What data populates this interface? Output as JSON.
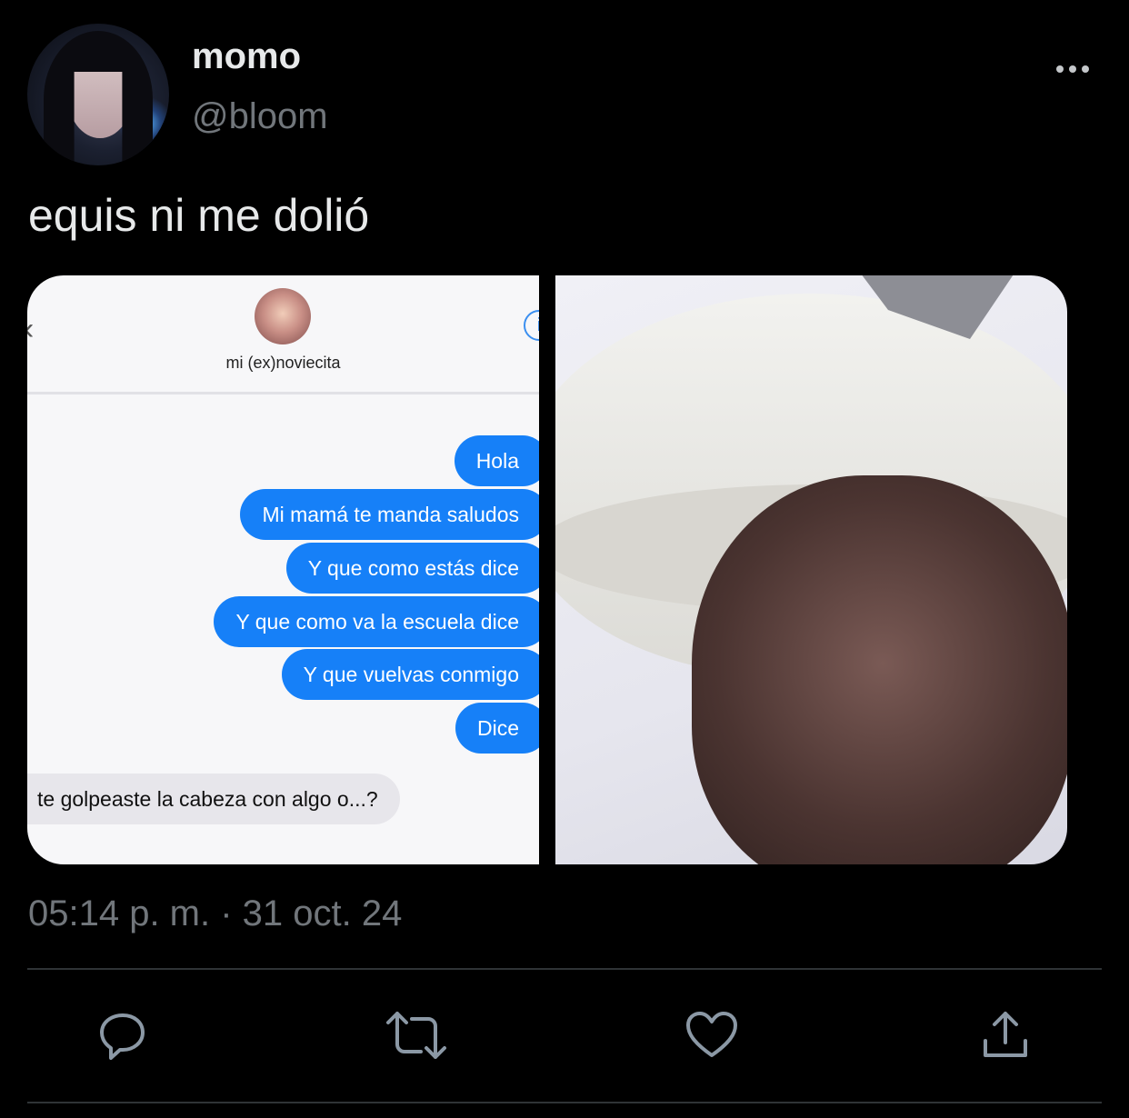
{
  "author": {
    "name": "momo",
    "handle": "@bloom"
  },
  "tweet": {
    "text": "equis ni me dolió",
    "timestamp": "05:14 p. m. · 31 oct. 24"
  },
  "menu_icon": "more-horizontal-icon",
  "media": {
    "chat": {
      "contact_name": "mi (ex)noviecita",
      "back_icon": "chevron-left-icon",
      "info_icon": "info-icon",
      "outgoing": [
        "Hola",
        "Mi mamá te manda saludos",
        "Y que como estás dice",
        "Y que como va la escuela dice",
        "Y que vuelvas conmigo",
        "Dice"
      ],
      "incoming": "te golpeaste la cabeza con algo o...?"
    }
  },
  "actions": {
    "reply_icon": "reply-icon",
    "retweet_icon": "retweet-icon",
    "like_icon": "heart-icon",
    "share_icon": "share-icon"
  },
  "colors": {
    "background": "#000000",
    "secondary_text": "#71767b",
    "bubble_blue": "#1680f8",
    "bubble_gray": "#e7e6eb"
  }
}
